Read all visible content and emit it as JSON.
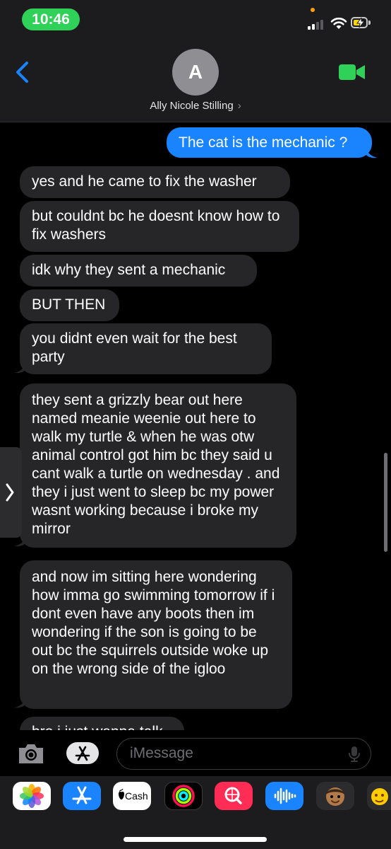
{
  "status_bar": {
    "time": "10:46"
  },
  "header": {
    "avatar_initial": "A",
    "contact_name": "Ally Nicole Stilling",
    "name_chevron": "›"
  },
  "messages": [
    {
      "side": "outgoing",
      "text": "The cat is the mechanic ?"
    },
    {
      "side": "incoming",
      "text": "yes and he came to fix the washer"
    },
    {
      "side": "incoming",
      "text": "but couldnt bc he doesnt know how to fix washers"
    },
    {
      "side": "incoming",
      "text": "idk why they sent a mechanic"
    },
    {
      "side": "incoming",
      "text": "BUT THEN"
    },
    {
      "side": "incoming",
      "text": "you didnt even wait for the best party"
    },
    {
      "side": "incoming",
      "text": "they sent a grizzly bear out here named meanie weenie out here to walk my turtle & when he was otw animal control got him bc they said u cant walk a turtle on wednesday . and they i just went to sleep bc my power wasnt working because i broke my mirror"
    },
    {
      "side": "incoming",
      "text": "and now im sitting here wondering how imma go swimming tomorrow if i dont even have any boots then im wondering if the son is going to be out bc the squirrels outside woke up on the wrong side of the igloo"
    },
    {
      "side": "incoming",
      "text": "bro i just wanna talk"
    }
  ],
  "input": {
    "placeholder": "iMessage"
  },
  "drawer": {
    "apps": [
      {
        "name": "photos-app-icon"
      },
      {
        "name": "app-store-app-icon"
      },
      {
        "name": "apple-cash-app-icon",
        "label": "Cash"
      },
      {
        "name": "activity-app-icon"
      },
      {
        "name": "image-search-app-icon"
      },
      {
        "name": "audio-message-app-icon"
      },
      {
        "name": "memoji-app-icon"
      },
      {
        "name": "memoji-stickers-app-icon"
      }
    ]
  },
  "colors": {
    "outgoing_bubble": "#1a84ff",
    "incoming_bubble": "#262628",
    "time_pill": "#30d158",
    "facetime": "#30d158",
    "back_chevron": "#1a84ff"
  }
}
